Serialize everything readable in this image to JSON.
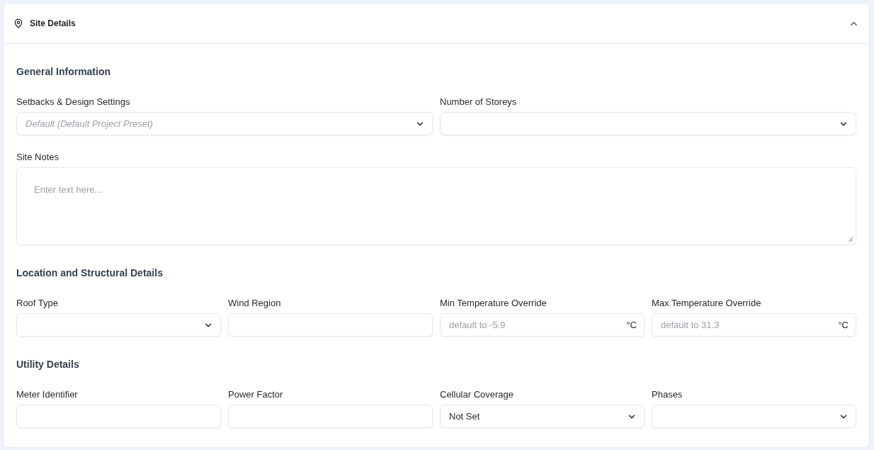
{
  "panel": {
    "title": "Site Details",
    "expanded": true,
    "sections": [
      {
        "heading": "General Information",
        "rows": [
          [
            {
              "kind": "select",
              "label": "Setbacks & Design Settings",
              "placeholder": "Default (Default Project Preset)"
            },
            {
              "kind": "select",
              "label": "Number of Storeys"
            }
          ],
          [
            {
              "kind": "textarea",
              "label": "Site Notes",
              "placeholder": "Enter text here..."
            }
          ]
        ]
      },
      {
        "heading": "Location and Structural Details",
        "rows": [
          [
            {
              "kind": "select",
              "label": "Roof Type"
            },
            {
              "kind": "text",
              "label": "Wind Region"
            },
            {
              "kind": "unit",
              "label": "Min Temperature Override",
              "placeholder": "default to -5.9",
              "unit": "°C"
            },
            {
              "kind": "unit",
              "label": "Max Temperature Override",
              "placeholder": "default to 31.3",
              "unit": "°C"
            }
          ]
        ]
      },
      {
        "heading": "Utility Details",
        "rows": [
          [
            {
              "kind": "text",
              "label": "Meter Identifier"
            },
            {
              "kind": "text",
              "label": "Power Factor"
            },
            {
              "kind": "select",
              "label": "Cellular Coverage",
              "value": "Not Set"
            },
            {
              "kind": "select",
              "label": "Phases"
            }
          ]
        ]
      }
    ]
  }
}
